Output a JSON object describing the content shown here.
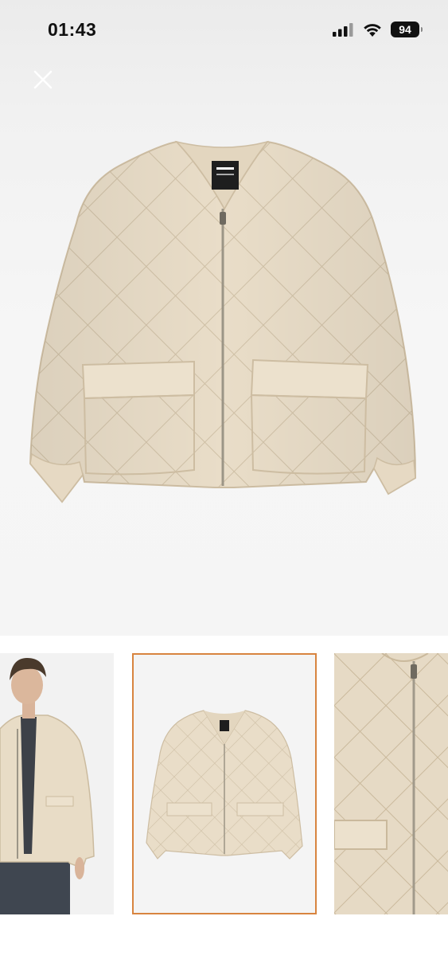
{
  "status_bar": {
    "time": "01:43",
    "battery": "94",
    "icons": [
      "cellular-signal-icon",
      "wifi-icon",
      "battery-icon"
    ]
  },
  "viewer": {
    "close_icon": "close-icon",
    "main_image": "quilted-jacket-product-photo",
    "selected_thumbnail_index": 1
  },
  "thumbnails": [
    {
      "image": "model-wearing-jacket-photo"
    },
    {
      "image": "jacket-flat-lay-photo"
    },
    {
      "image": "jacket-detail-closeup-photo"
    }
  ],
  "colors": {
    "jacket": "#e8dcc6",
    "selected_border": "#d8843f",
    "background": "#f5f5f5"
  }
}
